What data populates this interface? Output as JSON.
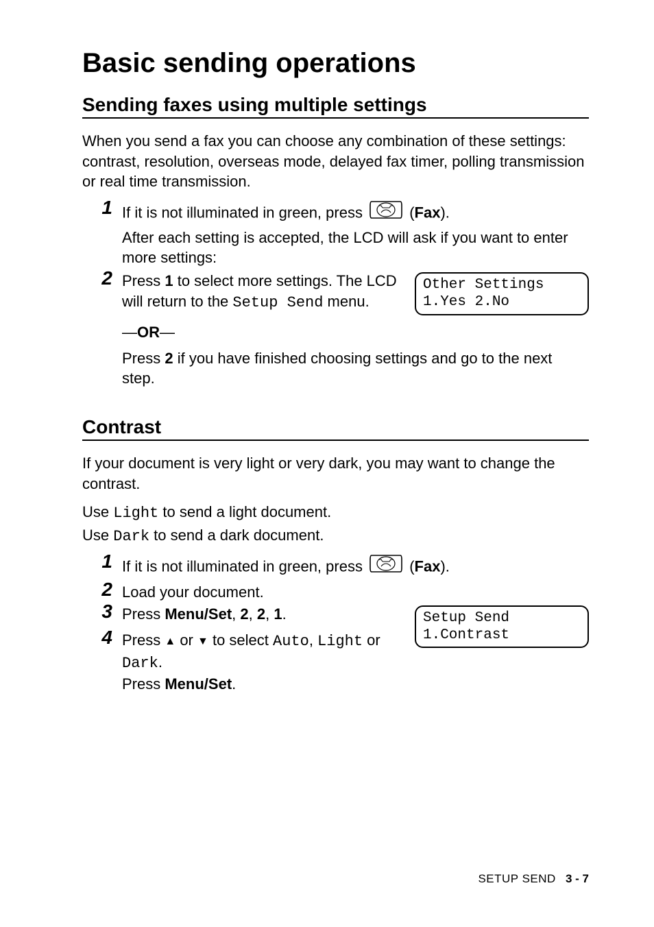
{
  "title": "Basic sending operations",
  "section1": {
    "heading": "Sending faxes using multiple settings",
    "intro": "When you send a fax you can choose any combination of these settings: contrast, resolution, overseas mode, delayed fax timer, polling transmission or real time transmission.",
    "step1_prefix": "If it is not illuminated in green, press ",
    "step1_faxOpen": " (",
    "step1_faxWord": "Fax",
    "step1_faxClose": ").",
    "step1_cont": "After each setting is accepted, the LCD will ask if you want to enter more settings:",
    "step2_a": "Press ",
    "step2_a_bold1": "1",
    "step2_b": " to select more settings. The LCD will return to the ",
    "step2_mono": "Setup Send",
    "step2_c": " menu.",
    "or_dash": "—",
    "or_word": "OR",
    "step2_alt_a": "Press ",
    "step2_alt_bold2": "2",
    "step2_alt_b": " if you have finished choosing settings and go to the next step.",
    "lcd_line1": "Other Settings",
    "lcd_line2": "1.Yes 2.No"
  },
  "section2": {
    "heading": "Contrast",
    "intro": "If your document is very light or very dark, you may want to change the contrast.",
    "use_light_a": "Use ",
    "use_light_mono": "Light",
    "use_light_b": " to send a light document.",
    "use_dark_a": "Use ",
    "use_dark_mono": "Dark",
    "use_dark_b": " to send a dark document.",
    "step1_prefix": "If it is not illuminated in green, press ",
    "step1_faxOpen": " (",
    "step1_faxWord": "Fax",
    "step1_faxClose": ").",
    "step2": "Load your document.",
    "step3_a": "Press ",
    "step3_bold_menu": "Menu/Set",
    "step3_sep": ", ",
    "step3_b1": "2",
    "step3_b2": "2",
    "step3_b3": "1",
    "step3_end": ".",
    "step4_a": "Press ",
    "step4_b": " or ",
    "step4_c": " to select ",
    "step4_mono_auto": "Auto",
    "step4_sep2": ", ",
    "step4_mono_light": "Light",
    "step4_d": " or ",
    "step4_mono_dark": "Dark",
    "step4_end": ".",
    "press_a": "Press ",
    "press_bold": "Menu/Set",
    "press_end": ".",
    "lcd_line1": "Setup Send",
    "lcd_line2": "1.Contrast"
  },
  "steps_numbers": {
    "n1": "1",
    "n2": "2",
    "n3": "3",
    "n4": "4"
  },
  "footer": {
    "chapter": "SETUP SEND",
    "page": "3 - 7"
  },
  "icons": {
    "fax": "fax-icon",
    "up": "▲",
    "down": "▼"
  }
}
